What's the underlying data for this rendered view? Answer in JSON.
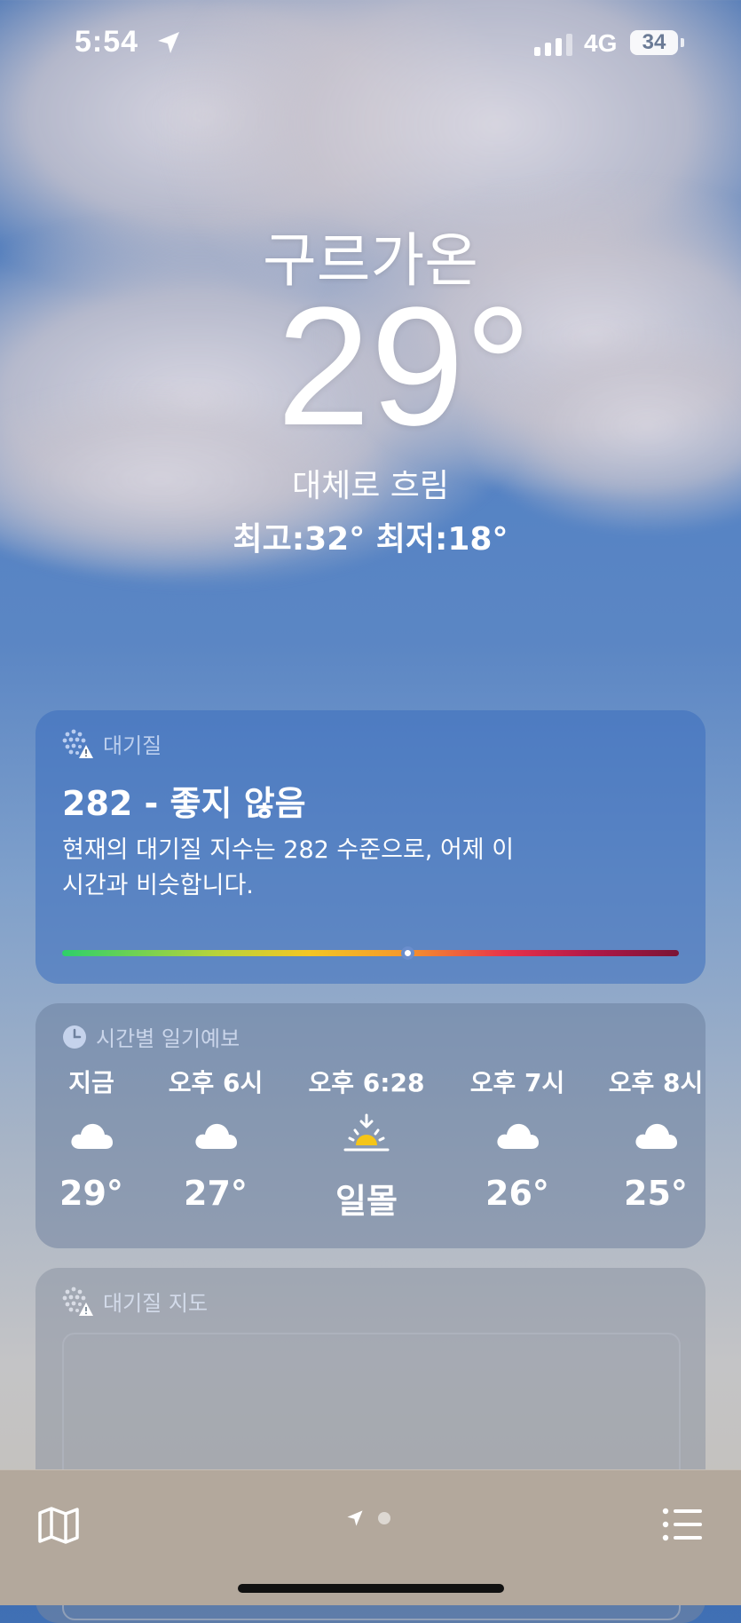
{
  "status_bar": {
    "time": "5:54",
    "network": "4G",
    "battery": "34",
    "icons": [
      "location-arrow-icon",
      "signal-icon",
      "battery-icon"
    ]
  },
  "header": {
    "location": "구르가온",
    "temperature": "29°",
    "condition": "대체로 흐림",
    "high_low": "최고:32°  최저:18°"
  },
  "air_quality": {
    "title": "대기질",
    "value_label": "282 - 좋지 않음",
    "description": "현재의 대기질 지수는 282 수준으로, 어제 이 시간과 비슷합니다.",
    "scale_position": 0.56,
    "icon": "air-quality-icon"
  },
  "hourly": {
    "title": "시간별 일기예보",
    "icon": "clock-icon",
    "items": [
      {
        "label": "지금",
        "icon": "cloud-icon",
        "value": "29°"
      },
      {
        "label": "오후 6시",
        "icon": "cloud-icon",
        "value": "27°"
      },
      {
        "label": "오후 6:28",
        "icon": "sunset-icon",
        "value": "일몰"
      },
      {
        "label": "오후 7시",
        "icon": "cloud-icon",
        "value": "26°"
      },
      {
        "label": "오후 8시",
        "icon": "cloud-icon",
        "value": "25°"
      }
    ]
  },
  "air_map": {
    "title": "대기질 지도",
    "icon": "air-quality-icon"
  },
  "tab_bar": {
    "icons": [
      "map-icon",
      "location-arrow-icon",
      "page-dot",
      "list-icon"
    ]
  },
  "colors": {
    "sun": "#f5c518",
    "aqi_gradient": [
      "#2ecf6a",
      "#f4c624",
      "#e8324a",
      "#7a1434"
    ]
  }
}
